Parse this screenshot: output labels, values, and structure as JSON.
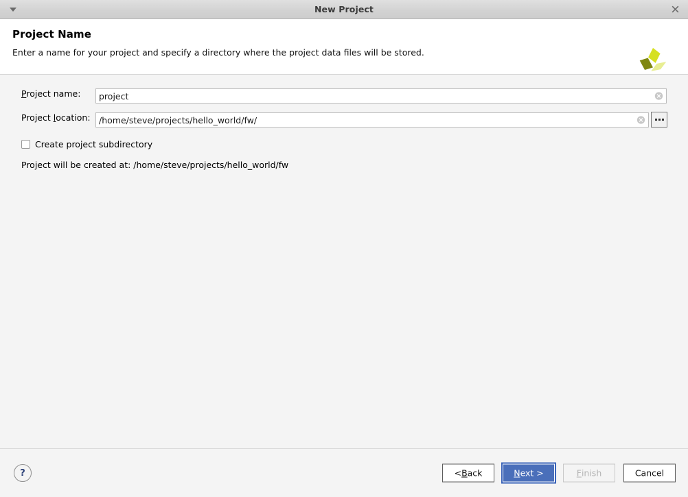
{
  "titlebar": {
    "title": "New Project",
    "menu_icon": "chevron-down-icon",
    "close_icon": "close-icon"
  },
  "header": {
    "title": "Project Name",
    "subtitle": "Enter a name for your project and specify a directory where the project data files will be stored.",
    "logo_name": "pinwheel-logo",
    "logo_colors": {
      "top_blade": "#d6e021",
      "left_blade": "#7f8711",
      "right_blade": "#e8ee93"
    }
  },
  "form": {
    "project_name": {
      "label_pre": "P",
      "label_post": "roject name:",
      "value": "project",
      "placeholder": "",
      "clear_icon": "clear-circle-icon"
    },
    "project_location": {
      "label_pre": "Project ",
      "label_mnemonic": "l",
      "label_post": "ocation:",
      "value": "/home/steve/projects/hello_world/fw/",
      "placeholder": "",
      "clear_icon": "clear-circle-icon",
      "browse_label": "...",
      "browse_icon": "ellipsis-icon"
    },
    "create_subdirectory": {
      "label": "Create project subdirectory",
      "checked": false
    },
    "status": "Project will be created at: /home/steve/projects/hello_world/fw"
  },
  "footer": {
    "help_label": "?",
    "help_icon": "question-mark-icon",
    "buttons": {
      "back": {
        "pre": "< ",
        "mnemonic": "B",
        "post": "ack",
        "label": "< Back",
        "enabled": true
      },
      "next": {
        "pre": "",
        "mnemonic": "N",
        "post": "ext >",
        "label": "Next >",
        "enabled": true,
        "default": true
      },
      "finish": {
        "pre": "",
        "mnemonic": "F",
        "post": "inish",
        "label": "Finish",
        "enabled": false
      },
      "cancel": {
        "label": "Cancel",
        "enabled": true
      }
    }
  },
  "colors": {
    "accent": "#4a6fba",
    "window_bg": "#f4f4f4",
    "header_bg": "#ffffff",
    "titlebar_bg": "#d3d3d3"
  }
}
